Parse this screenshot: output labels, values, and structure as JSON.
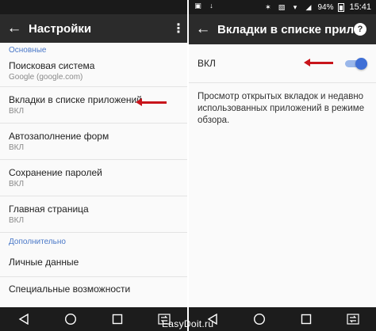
{
  "left": {
    "toolbar": {
      "back_icon": "arrow-left-icon",
      "title": "Настройки",
      "menu_icon": "overflow-menu-icon"
    },
    "section_basic": "Основные",
    "items": [
      {
        "title": "Поисковая система",
        "subtitle": "Google (google.com)"
      },
      {
        "title": "Вкладки в списке приложений",
        "subtitle": "ВКЛ"
      },
      {
        "title": "Автозаполнение форм",
        "subtitle": "ВКЛ"
      },
      {
        "title": "Сохранение паролей",
        "subtitle": "ВКЛ"
      },
      {
        "title": "Главная страница",
        "subtitle": "ВКЛ"
      }
    ],
    "section_advanced": "Дополнительно",
    "items_advanced": [
      {
        "title": "Личные данные"
      },
      {
        "title": "Специальные возможности"
      }
    ]
  },
  "right": {
    "status": {
      "battery": "94%",
      "time": "15:41"
    },
    "toolbar": {
      "back_icon": "arrow-left-icon",
      "title": "Вкладки в списке прило",
      "help_icon": "help-icon"
    },
    "toggle": {
      "label": "ВКЛ",
      "state": true
    },
    "description": "Просмотр открытых вкладок и недавно использованных приложений в режиме обзора."
  },
  "watermark": "EasyDoit.ru",
  "colors": {
    "accent": "#3f6fd6",
    "toolbar": "#2b2b2b",
    "annotation_arrow": "#c8141b",
    "section": "#4a78c8"
  }
}
